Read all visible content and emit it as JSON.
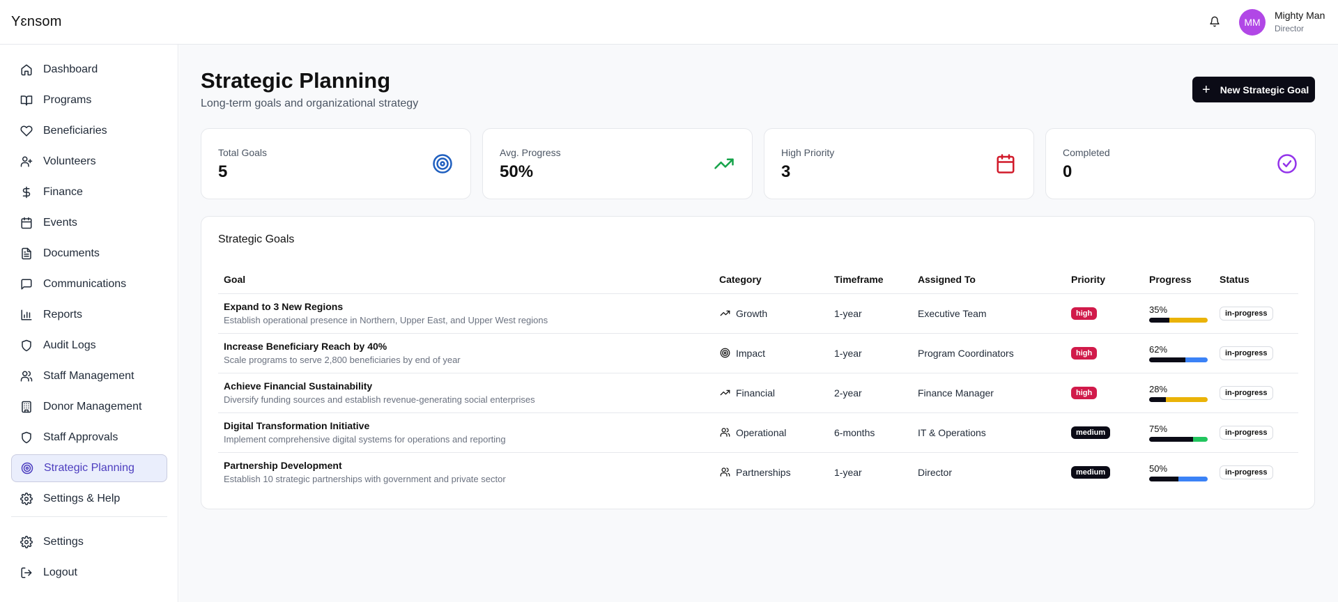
{
  "app": {
    "brand": "Yɛnsom"
  },
  "user": {
    "initials": "MM",
    "name": "Mighty Man",
    "role": "Director"
  },
  "sidebar": {
    "items": [
      {
        "label": "Dashboard",
        "icon": "home-icon"
      },
      {
        "label": "Programs",
        "icon": "book-icon"
      },
      {
        "label": "Beneficiaries",
        "icon": "heart-icon"
      },
      {
        "label": "Volunteers",
        "icon": "user-plus-icon"
      },
      {
        "label": "Finance",
        "icon": "dollar-icon"
      },
      {
        "label": "Events",
        "icon": "calendar-icon"
      },
      {
        "label": "Documents",
        "icon": "file-icon"
      },
      {
        "label": "Communications",
        "icon": "message-icon"
      },
      {
        "label": "Reports",
        "icon": "bar-chart-icon"
      },
      {
        "label": "Audit Logs",
        "icon": "shield-icon"
      },
      {
        "label": "Staff Management",
        "icon": "users-icon"
      },
      {
        "label": "Donor Management",
        "icon": "building-icon"
      },
      {
        "label": "Staff Approvals",
        "icon": "shield-icon"
      },
      {
        "label": "Strategic Planning",
        "icon": "target-icon",
        "active": true
      },
      {
        "label": "Settings & Help",
        "icon": "gear-icon"
      }
    ],
    "bottom": [
      {
        "label": "Settings",
        "icon": "gear-icon"
      },
      {
        "label": "Logout",
        "icon": "logout-icon"
      }
    ]
  },
  "page": {
    "title": "Strategic Planning",
    "subtitle": "Long-term goals and organizational strategy",
    "new_button": "New Strategic Goal"
  },
  "stats": [
    {
      "label": "Total Goals",
      "value": "5",
      "icon": "target-icon",
      "color": "#1f5fbf"
    },
    {
      "label": "Avg. Progress",
      "value": "50%",
      "icon": "trending-up-icon",
      "color": "#16a34a"
    },
    {
      "label": "High Priority",
      "value": "3",
      "icon": "calendar-icon",
      "color": "#d11a2a"
    },
    {
      "label": "Completed",
      "value": "0",
      "icon": "check-circle-icon",
      "color": "#9333ea"
    }
  ],
  "goals_card": {
    "title": "Strategic Goals",
    "columns": [
      "Goal",
      "Category",
      "Timeframe",
      "Assigned To",
      "Priority",
      "Progress",
      "Status"
    ],
    "rows": [
      {
        "title": "Expand to 3 New Regions",
        "desc": "Establish operational presence in Northern, Upper East, and Upper West regions",
        "category": "Growth",
        "category_icon": "trending-up-icon",
        "timeframe": "1-year",
        "assigned": "Executive Team",
        "priority": "high",
        "progress": 35,
        "progress_label": "35%",
        "bar_color": "#eab308",
        "status": "in-progress"
      },
      {
        "title": "Increase Beneficiary Reach by 40%",
        "desc": "Scale programs to serve 2,800 beneficiaries by end of year",
        "category": "Impact",
        "category_icon": "target-icon",
        "timeframe": "1-year",
        "assigned": "Program Coordinators",
        "priority": "high",
        "progress": 62,
        "progress_label": "62%",
        "bar_color": "#3b82f6",
        "status": "in-progress"
      },
      {
        "title": "Achieve Financial Sustainability",
        "desc": "Diversify funding sources and establish revenue-generating social enterprises",
        "category": "Financial",
        "category_icon": "trending-up-icon",
        "timeframe": "2-year",
        "assigned": "Finance Manager",
        "priority": "high",
        "progress": 28,
        "progress_label": "28%",
        "bar_color": "#eab308",
        "status": "in-progress"
      },
      {
        "title": "Digital Transformation Initiative",
        "desc": "Implement comprehensive digital systems for operations and reporting",
        "category": "Operational",
        "category_icon": "users-icon",
        "timeframe": "6-months",
        "assigned": "IT & Operations",
        "priority": "medium",
        "progress": 75,
        "progress_label": "75%",
        "bar_color": "#22c55e",
        "status": "in-progress"
      },
      {
        "title": "Partnership Development",
        "desc": "Establish 10 strategic partnerships with government and private sector",
        "category": "Partnerships",
        "category_icon": "users-icon",
        "timeframe": "1-year",
        "assigned": "Director",
        "priority": "medium",
        "progress": 50,
        "progress_label": "50%",
        "bar_color": "#3b82f6",
        "status": "in-progress"
      }
    ]
  }
}
